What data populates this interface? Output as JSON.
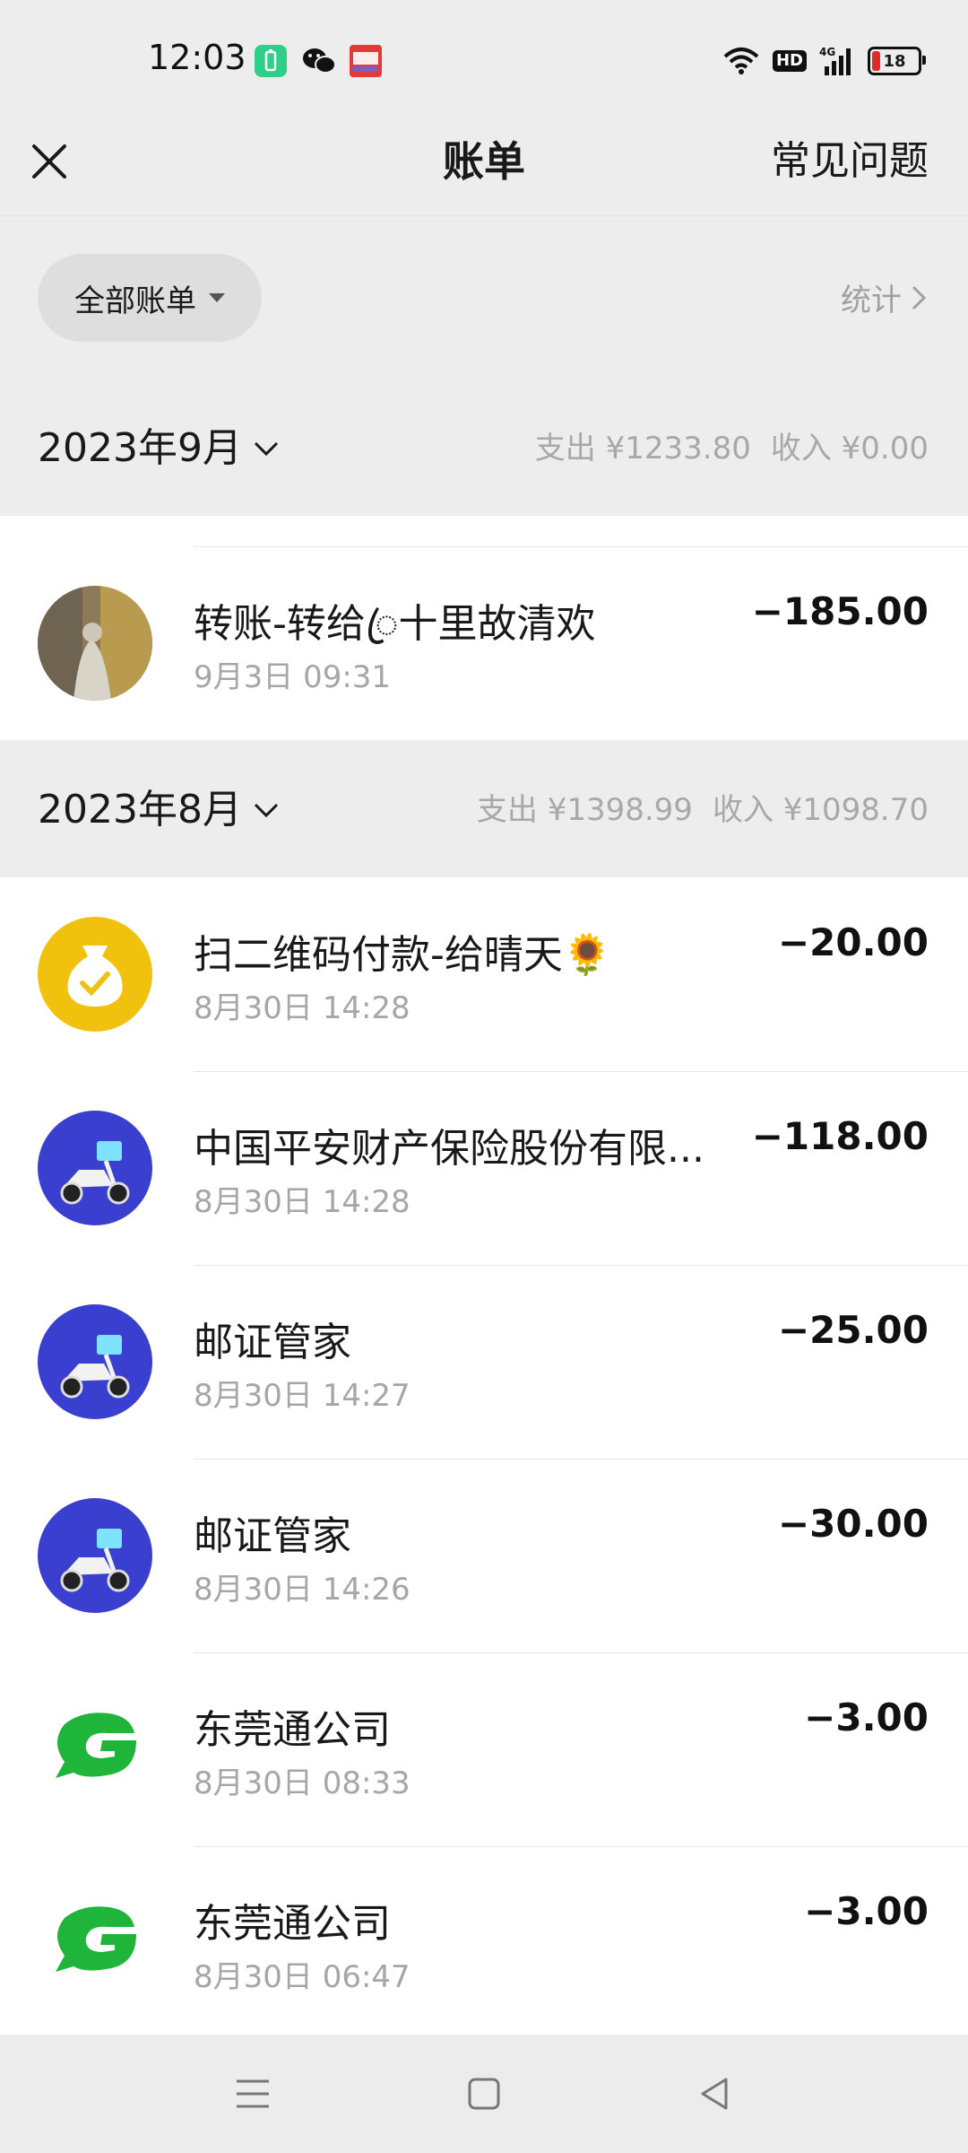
{
  "status_bar": {
    "time": "12:03",
    "network": "4G",
    "hd_label": "HD",
    "battery": "18",
    "icons": [
      "battery-saver-app-icon",
      "wechat-app-icon",
      "toutiao-app-icon",
      "wifi-icon",
      "hd-icon",
      "signal-icon",
      "battery-icon"
    ]
  },
  "nav": {
    "title": "账单",
    "faq": "常见问题",
    "close_icon": "close-icon"
  },
  "filter": {
    "label": "全部账单",
    "stats": "统计"
  },
  "months": [
    {
      "label": "2023年9月",
      "expense": "支出 ¥1233.80",
      "income": "收入 ¥0.00",
      "transactions": [
        {
          "title": "转账-转给ꦿ十里故清欢",
          "time": "9月3日 09:31",
          "amount": "−185.00",
          "avatar": "photo-avatar"
        }
      ]
    },
    {
      "label": "2023年8月",
      "expense": "支出 ¥1398.99",
      "income": "收入 ¥1098.70",
      "transactions": [
        {
          "title": "扫二维码付款-给晴天🌻",
          "time": "8月30日 14:28",
          "amount": "−20.00",
          "avatar": "money-bag-icon"
        },
        {
          "title": "中国平安财产保险股份有限...",
          "time": "8月30日 14:28",
          "amount": "−118.00",
          "avatar": "scooter-icon"
        },
        {
          "title": "邮证管家",
          "time": "8月30日 14:27",
          "amount": "−25.00",
          "avatar": "scooter-icon"
        },
        {
          "title": "邮证管家",
          "time": "8月30日 14:26",
          "amount": "−30.00",
          "avatar": "scooter-icon"
        },
        {
          "title": "东莞通公司",
          "time": "8月30日 08:33",
          "amount": "−3.00",
          "avatar": "dongguantong-logo"
        },
        {
          "title": "东莞通公司",
          "time": "8月30日 06:47",
          "amount": "−3.00",
          "avatar": "dongguantong-logo"
        }
      ]
    }
  ],
  "system_nav": [
    "menu-icon",
    "home-icon",
    "back-icon"
  ],
  "colors": {
    "background": "#ededed",
    "card": "#ffffff",
    "muted_text": "#a6a6a6",
    "gold_avatar": "#f0c20e",
    "scooter_avatar": "#3a3fd0",
    "dongguantong_green": "#1eb53a",
    "battery_low": "#e02b2b"
  }
}
